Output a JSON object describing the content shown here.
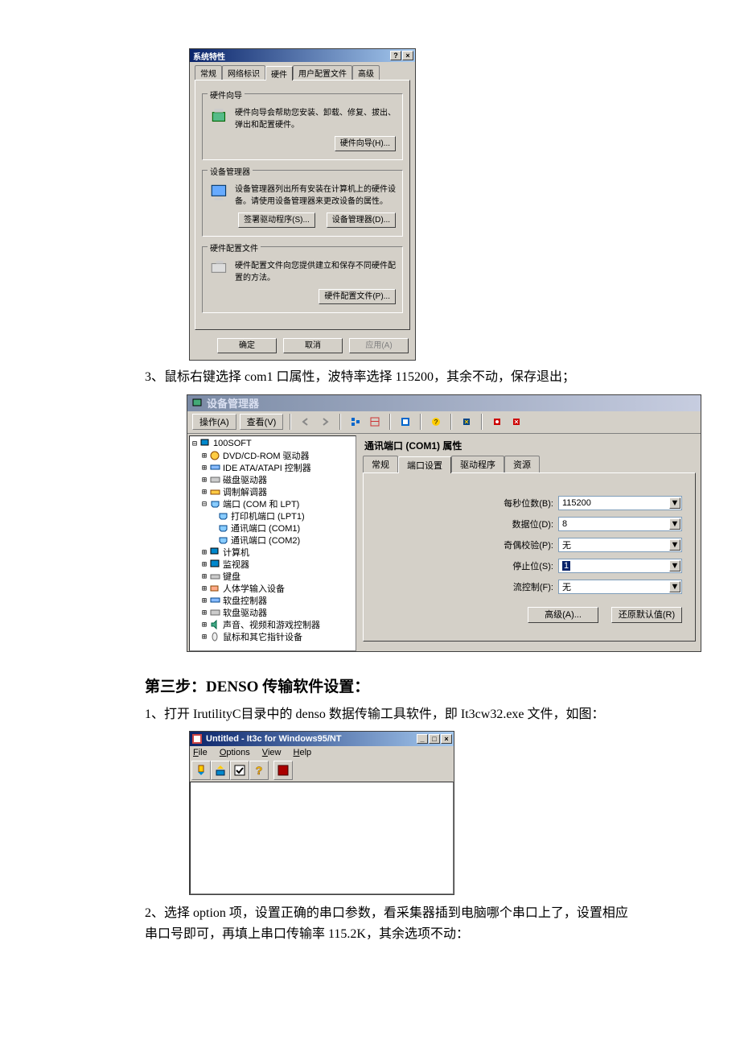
{
  "sysprops": {
    "title": "系统特性",
    "tabs": [
      "常规",
      "网络标识",
      "硬件",
      "用户配置文件",
      "高级"
    ],
    "active_tab": "硬件",
    "group1": {
      "legend": "硬件向导",
      "desc": "硬件向导会帮助您安装、卸载、修复、拔出、弹出和配置硬件。",
      "btn": "硬件向导(H)..."
    },
    "group2": {
      "legend": "设备管理器",
      "desc": "设备管理器列出所有安装在计算机上的硬件设备。请使用设备管理器来更改设备的属性。",
      "btn_left": "签署驱动程序(S)...",
      "btn_right": "设备管理器(D)..."
    },
    "group3": {
      "legend": "硬件配置文件",
      "desc": "硬件配置文件向您提供建立和保存不同硬件配置的方法。",
      "btn": "硬件配置文件(P)..."
    },
    "footer": {
      "ok": "确定",
      "cancel": "取消",
      "apply": "应用(A)"
    }
  },
  "step3_line": "3、鼠标右键选择 com1 口属性，波特率选择 115200，其余不动，保存退出；",
  "devmgr": {
    "title": "设备管理器",
    "menu_action": "操作(A)",
    "menu_view": "查看(V)",
    "tree": {
      "root": "100SOFT",
      "items": [
        "DVD/CD-ROM 驱动器",
        "IDE ATA/ATAPI 控制器",
        "磁盘驱动器",
        "调制解调器",
        "端口 (COM 和 LPT)",
        "打印机端口 (LPT1)",
        "通讯端口 (COM1)",
        "通讯端口 (COM2)",
        "计算机",
        "监视器",
        "键盘",
        "人体学输入设备",
        "软盘控制器",
        "软盘驱动器",
        "声音、视频和游戏控制器",
        "鼠标和其它指针设备"
      ]
    }
  },
  "com1": {
    "title": "通讯端口 (COM1) 属性",
    "tabs": [
      "常规",
      "端口设置",
      "驱动程序",
      "资源"
    ],
    "active": "端口设置",
    "fields": {
      "bps_label": "每秒位数(B):",
      "bps_value": "115200",
      "databits_label": "数据位(D):",
      "databits_value": "8",
      "parity_label": "奇偶校验(P):",
      "parity_value": "无",
      "stopbits_label": "停止位(S):",
      "stopbits_value": "1",
      "flow_label": "流控制(F):",
      "flow_value": "无"
    },
    "btn_adv": "高级(A)...",
    "btn_restore": "还原默认值(R)"
  },
  "heading": "第三步：DENSO 传输软件设置：",
  "para1": "1、打开 IrutilityC目录中的 denso 数据传输工具软件，即 It3cw32.exe 文件，如图：",
  "it3c": {
    "title": "Untitled - It3c for Windows95/NT",
    "menu": [
      "File",
      "Options",
      "View",
      "Help"
    ]
  },
  "para2": "2、选择 option 项，设置正确的串口参数，看采集器插到电脑哪个串口上了，设置相应串口号即可，再填上串口传输率 115.2K，其余选项不动："
}
